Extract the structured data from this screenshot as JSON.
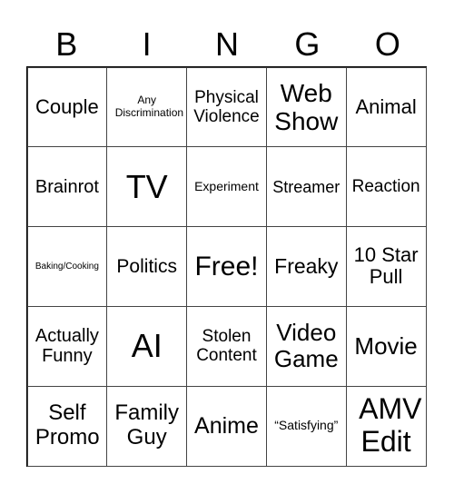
{
  "header": [
    "B",
    "I",
    "N",
    "G",
    "O"
  ],
  "cells": [
    "Couple",
    "Any Discrimination",
    "Physical Violence",
    "Web Show",
    "Animal",
    "Brainrot",
    "TV",
    "Experiment",
    "Streamer",
    "Reaction",
    "Baking/Cooking",
    "Politics",
    "Free!",
    "Freaky",
    "10 Star Pull",
    "Actually Funny",
    "AI",
    "Stolen Content",
    "Video Game",
    "Movie",
    "Self Promo",
    "Family Guy",
    "Anime",
    "“Satisfying”",
    "AMV Edit"
  ]
}
